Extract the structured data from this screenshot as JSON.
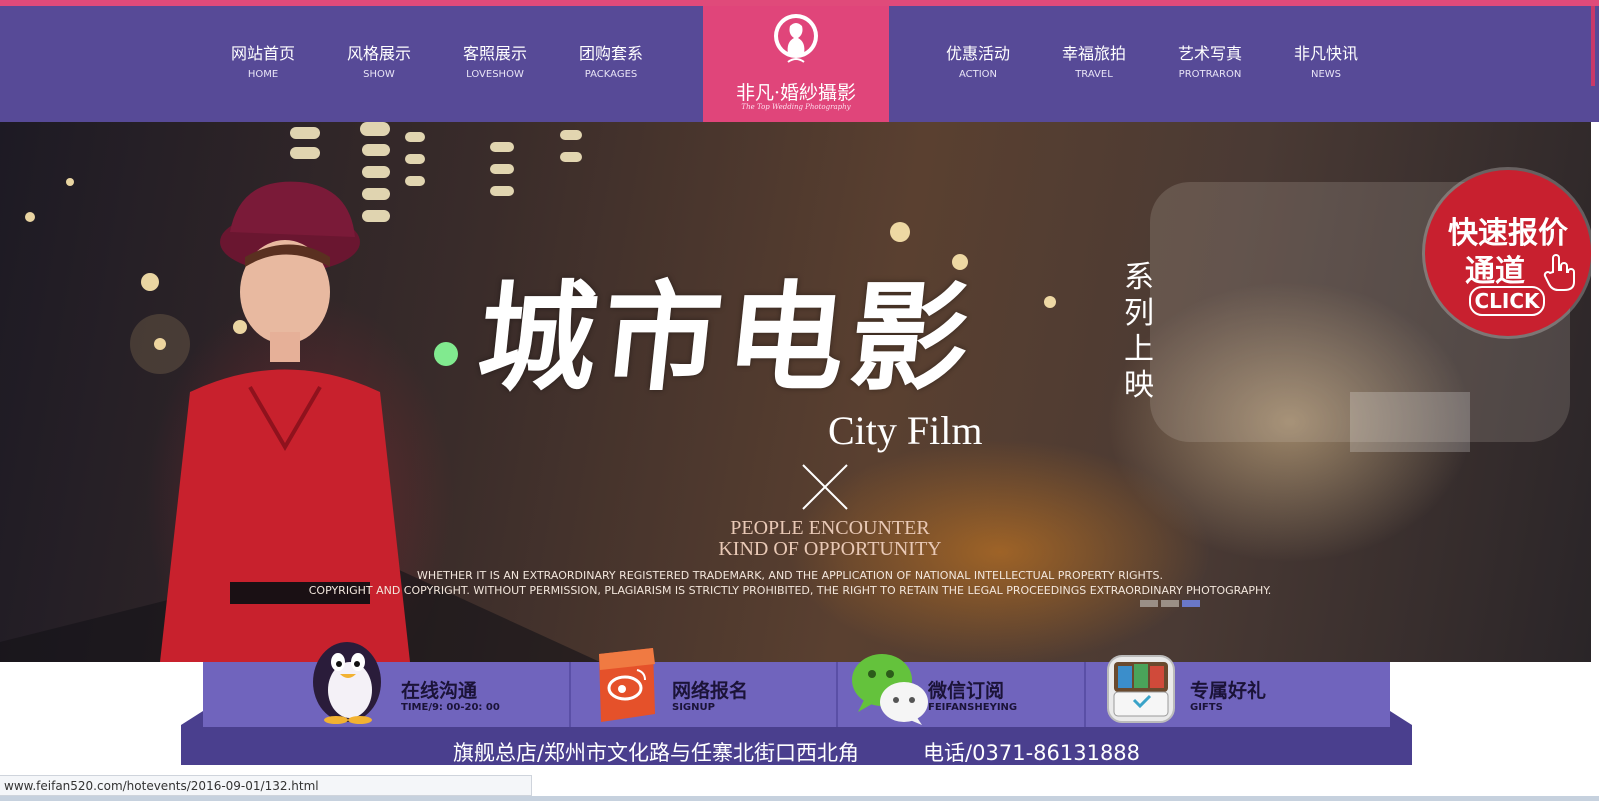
{
  "nav": {
    "left_items": [
      {
        "zh": "网站首页",
        "en": "HOME"
      },
      {
        "zh": "风格展示",
        "en": "SHOW"
      },
      {
        "zh": "客照展示",
        "en": "LOVESHOW"
      },
      {
        "zh": "团购套系",
        "en": "PACKAGES"
      }
    ],
    "right_items": [
      {
        "zh": "优惠活动",
        "en": "ACTION"
      },
      {
        "zh": "幸福旅拍",
        "en": "TRAVEL"
      },
      {
        "zh": "艺术写真",
        "en": "PROTRARON"
      },
      {
        "zh": "非凡快讯",
        "en": "NEWS"
      }
    ],
    "logo": {
      "name": "非凡·婚紗攝影",
      "tagline": "The Top Wedding Photography"
    }
  },
  "banner": {
    "headline": "城市电影",
    "vertical_text": "系列上映",
    "english_title": "City Film",
    "people_line1": "PEOPLE ENCOUNTER",
    "people_line2": "KIND OF OPPORTUNITY",
    "desc_line1": "WHETHER IT IS AN EXTRAORDINARY REGISTERED TRADEMARK, AND THE APPLICATION OF NATIONAL INTELLECTUAL PROPERTY RIGHTS.",
    "desc_line2": "COPYRIGHT AND COPYRIGHT. WITHOUT PERMISSION, PLAGIARISM IS STRICTLY PROHIBITED, THE RIGHT TO RETAIN THE LEGAL PROCEEDINGS EXTRAORDINARY PHOTOGRAPHY.",
    "slide_count": 3,
    "active_slide": 3
  },
  "quick_quote": {
    "line1": "快速报价",
    "line2": "通道",
    "click": "CLICK"
  },
  "features": [
    {
      "title": "在线沟通",
      "sub": "TIME/9: 00-20: 00",
      "icon": "penguin-icon"
    },
    {
      "title": "网络报名",
      "sub": "SIGNUP",
      "icon": "weibo-icon"
    },
    {
      "title": "微信订阅",
      "sub": "FEIFANSHEYING",
      "icon": "wechat-icon"
    },
    {
      "title": "专属好礼",
      "sub": "GIFTS",
      "icon": "gift-wallet-icon"
    }
  ],
  "address": {
    "store": "旗舰总店/郑州市文化路与任寨北街口西北角",
    "phone": "电话/0371-86131888"
  },
  "status_bar": {
    "url": "www.feifan520.com/hotevents/2016-09-01/132.html"
  },
  "colors": {
    "nav_bg": "#574a97",
    "logo_bg": "#e0457a",
    "accent_pink": "#e04a7a",
    "feature_bar": "#7064bd",
    "feature_base": "#4a3f8e",
    "badge_red": "#c8202f"
  }
}
